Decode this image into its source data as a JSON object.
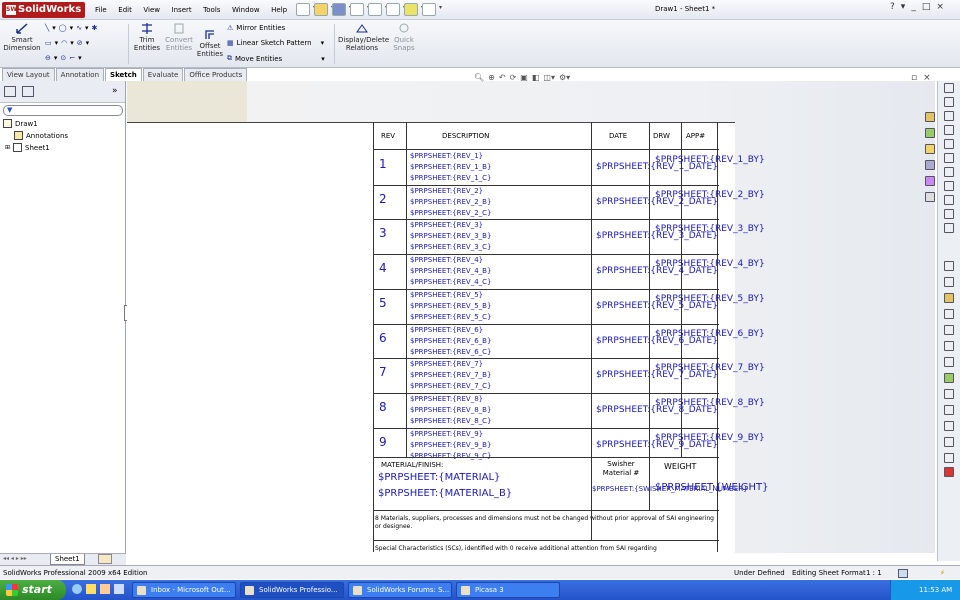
{
  "app": {
    "logo": "SolidWorks",
    "menus": [
      "File",
      "Edit",
      "View",
      "Insert",
      "Tools",
      "Window",
      "Help"
    ],
    "document_title": "Draw1 - Sheet1 *",
    "window_controls": [
      "?",
      "▾",
      "_",
      "□",
      "×"
    ]
  },
  "commands": {
    "smart_dimension": "Smart Dimension",
    "trim_entities": "Trim Entities",
    "convert_entities": "Convert Entities",
    "offset_entities": "Offset Entities",
    "mirror_entities": "Mirror Entities",
    "linear_sketch_pattern": "Linear Sketch Pattern",
    "move_entities": "Move Entities",
    "display_delete_relations": "Display/Delete Relations",
    "quick_snaps": "Quick Snaps"
  },
  "tabs": [
    "View Layout",
    "Annotation",
    "Sketch",
    "Evaluate",
    "Office Products"
  ],
  "active_tab": "Sketch",
  "feature_tree": {
    "root": "Draw1",
    "children": [
      "Annotations",
      "Sheet1"
    ]
  },
  "sheet_tab": "Sheet1",
  "revision_table": {
    "headers": {
      "rev": "REV",
      "description": "DESCRIPTION",
      "date": "DATE",
      "drw": "DRW",
      "appr": "APP#"
    },
    "rows": [
      {
        "rev": "1",
        "d1": "$PRPSHEET:{REV_1}",
        "d2": "$PRPSHEET:{REV_1_B}",
        "d3": "$PRPSHEET:{REV_1_C}",
        "date": "$PRPSHEET:{REV_1_DATE}",
        "by": "$PRPSHEET:{REV_1_BY}"
      },
      {
        "rev": "2",
        "d1": "$PRPSHEET:{REV_2}",
        "d2": "$PRPSHEET:{REV_2_B}",
        "d3": "$PRPSHEET:{REV_2_C}",
        "date": "$PRPSHEET:{REV_2_DATE}",
        "by": "$PRPSHEET:{REV_2_BY}"
      },
      {
        "rev": "3",
        "d1": "$PRPSHEET:{REV_3}",
        "d2": "$PRPSHEET:{REV_3_B}",
        "d3": "$PRPSHEET:{REV_3_C}",
        "date": "$PRPSHEET:{REV_3_DATE}",
        "by": "$PRPSHEET:{REV_3_BY}"
      },
      {
        "rev": "4",
        "d1": "$PRPSHEET:{REV_4}",
        "d2": "$PRPSHEET:{REV_4_B}",
        "d3": "$PRPSHEET:{REV_4_C}",
        "date": "$PRPSHEET:{REV_4_DATE}",
        "by": "$PRPSHEET:{REV_4_BY}"
      },
      {
        "rev": "5",
        "d1": "$PRPSHEET:{REV_5}",
        "d2": "$PRPSHEET:{REV_5_B}",
        "d3": "$PRPSHEET:{REV_5_C}",
        "date": "$PRPSHEET:{REV_5_DATE}",
        "by": "$PRPSHEET:{REV_5_BY}"
      },
      {
        "rev": "6",
        "d1": "$PRPSHEET:{REV_6}",
        "d2": "$PRPSHEET:{REV_6_B}",
        "d3": "$PRPSHEET:{REV_6_C}",
        "date": "$PRPSHEET:{REV_6_DATE}",
        "by": "$PRPSHEET:{REV_6_BY}"
      },
      {
        "rev": "7",
        "d1": "$PRPSHEET:{REV_7}",
        "d2": "$PRPSHEET:{REV_7_B}",
        "d3": "$PRPSHEET:{REV_7_C}",
        "date": "$PRPSHEET:{REV_7_DATE}",
        "by": "$PRPSHEET:{REV_7_BY}"
      },
      {
        "rev": "8",
        "d1": "$PRPSHEET:{REV_8}",
        "d2": "$PRPSHEET:{REV_8_B}",
        "d3": "$PRPSHEET:{REV_8_C}",
        "date": "$PRPSHEET:{REV_8_DATE}",
        "by": "$PRPSHEET:{REV_8_BY}"
      },
      {
        "rev": "9",
        "d1": "$PRPSHEET:{REV_9}",
        "d2": "$PRPSHEET:{REV_9_B}",
        "d3": "$PRPSHEET:{REV_9_C}",
        "date": "$PRPSHEET:{REV_9_DATE}",
        "by": "$PRPSHEET:{REV_9_BY}"
      }
    ],
    "material_label": "MATERIAL/FINISH:",
    "material_1": "$PRPSHEET:{MATERIAL}",
    "material_2": "$PRPSHEET:{MATERIAL_B}",
    "swisher_label": "Swisher Material #",
    "swisher_value": "$PRPSHEET:{SWISHER_MATERIAL_NUMBER}",
    "weight_label": "WEIGHT",
    "weight_value": "$PRPSHEET:{WEIGHT}",
    "note_1": "8 Materials, suppliers, processes and dimensions must not be changed without prior approval of SAI engineering or designee.",
    "note_2": "Special Characteristics (SCs), identified with 0 receive additional attention from SAI regarding"
  },
  "status": {
    "app_version": "SolidWorks Professional 2009 x64 Edition",
    "state": "Under Defined",
    "mode": "Editing Sheet Format",
    "scale": "1 : 1"
  },
  "taskbar": {
    "start": "start",
    "items": [
      "Inbox - Microsoft Out...",
      "SolidWorks Professio...",
      "SolidWorks Forums: S...",
      "Picasa 3"
    ],
    "clock": "11:53 AM"
  }
}
